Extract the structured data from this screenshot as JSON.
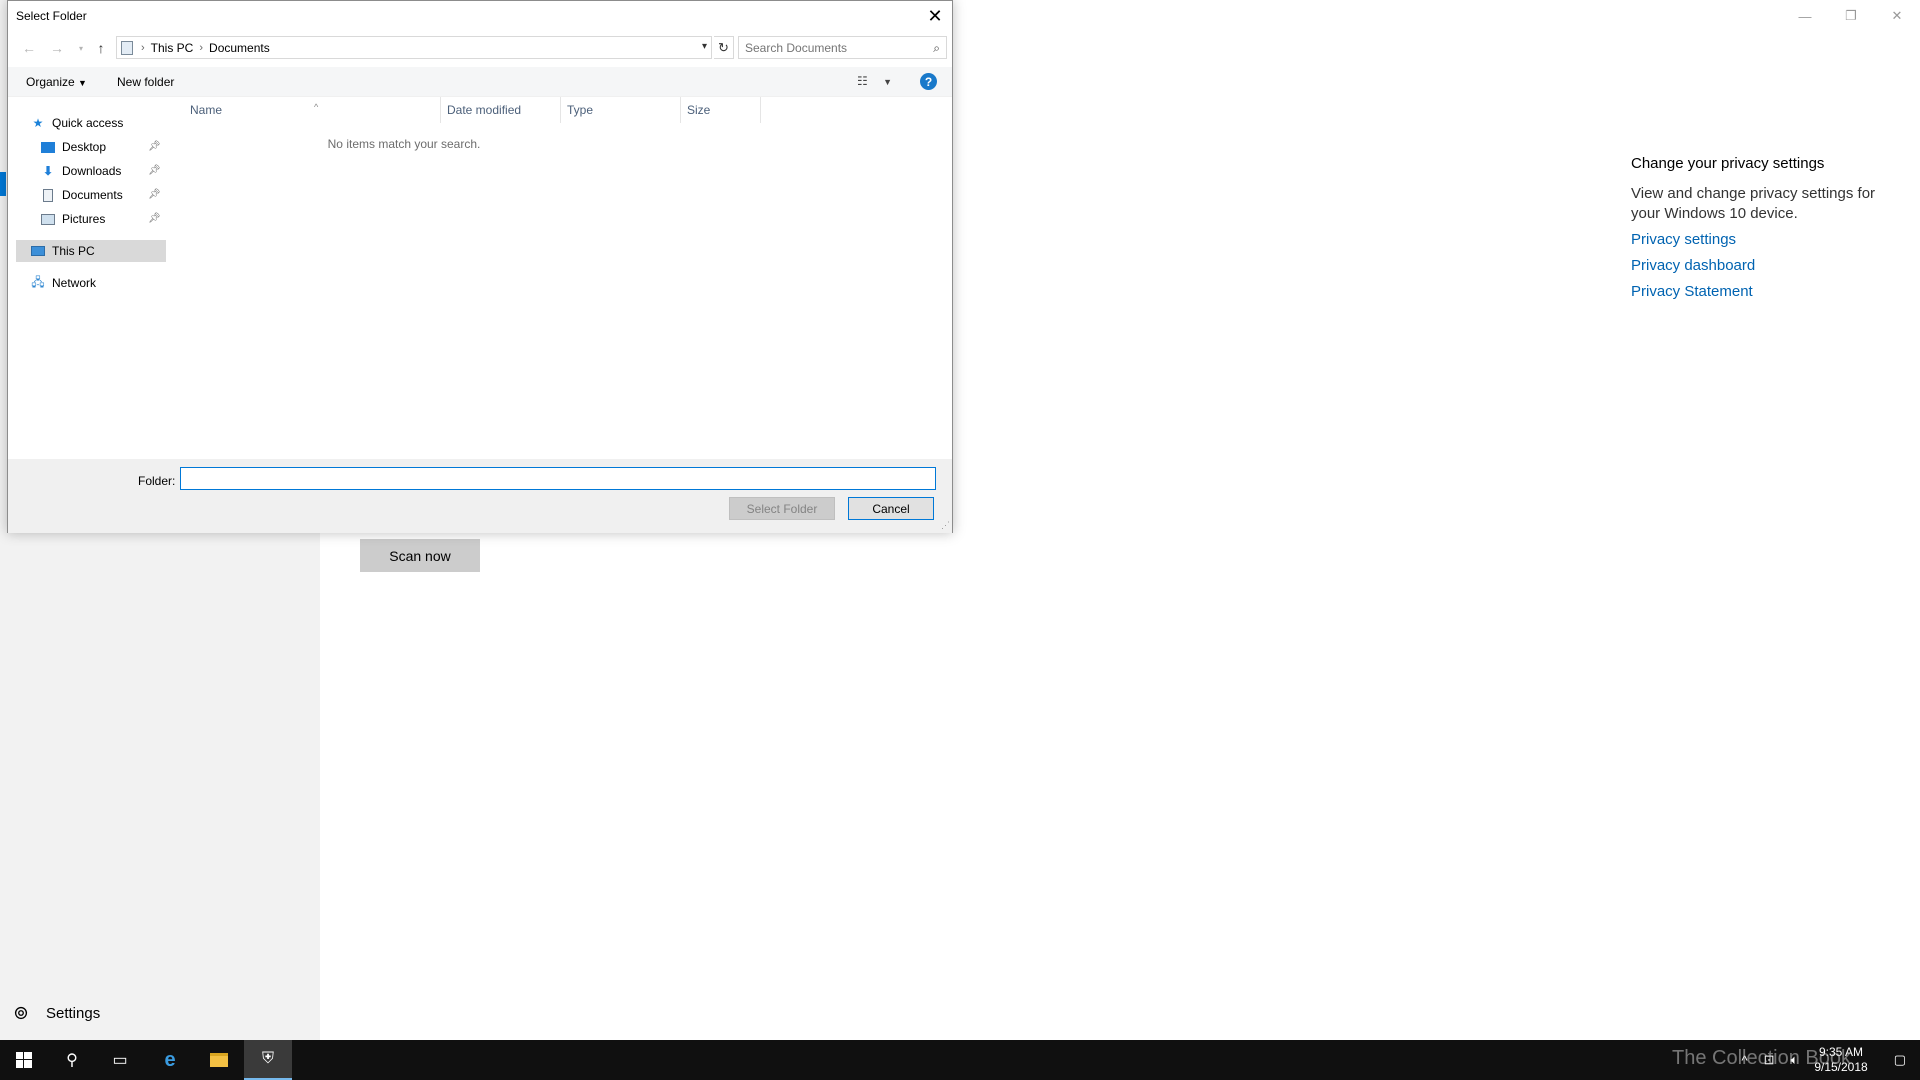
{
  "background_app": {
    "scan_button": "Scan now",
    "settings_label": "Settings",
    "privacy": {
      "title": "Change your privacy settings",
      "description": "View and change privacy settings for your Windows 10 device.",
      "links": [
        "Privacy settings",
        "Privacy dashboard",
        "Privacy Statement"
      ]
    }
  },
  "dialog": {
    "title": "Select Folder",
    "address": {
      "crumbs": [
        "This PC",
        "Documents"
      ]
    },
    "search_placeholder": "Search Documents",
    "toolbar": {
      "organize": "Organize",
      "new_folder": "New folder",
      "help": "?"
    },
    "nav": {
      "quick_access": "Quick access",
      "pinned": [
        "Desktop",
        "Downloads",
        "Documents",
        "Pictures"
      ],
      "this_pc": "This PC",
      "network": "Network"
    },
    "columns": [
      "Name",
      "Date modified",
      "Type",
      "Size"
    ],
    "empty_message": "No items match your search.",
    "folder_label": "Folder:",
    "folder_value": "",
    "select_button": "Select Folder",
    "cancel_button": "Cancel"
  },
  "taskbar": {
    "time": "9:35 AM",
    "date": "9/15/2018"
  },
  "watermark": "The Collection Book",
  "colors": {
    "accent": "#0078d7",
    "link": "#0063b1",
    "taskbar": "#101010"
  }
}
